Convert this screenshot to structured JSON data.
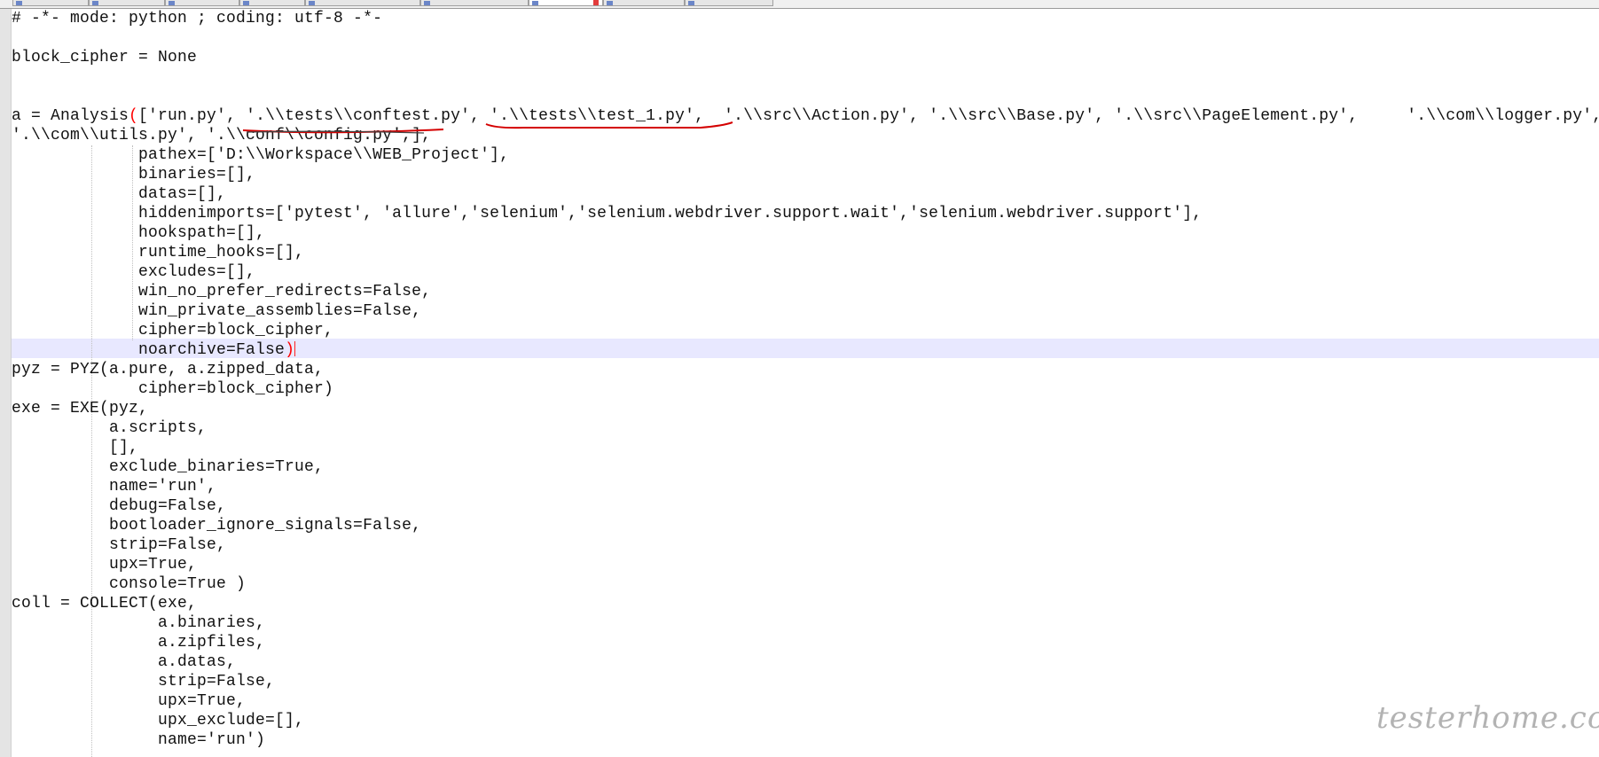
{
  "editor": {
    "lines": [
      {
        "text": "# -*- mode: python ; coding: utf-8 -*-"
      },
      {
        "text": ""
      },
      {
        "text": "block_cipher = None"
      },
      {
        "text": ""
      },
      {
        "text": ""
      },
      {
        "pre": "a = Analysis",
        "paren": "(",
        "post": "['run.py', '.\\\\tests\\\\conftest.py', '.\\\\tests\\\\test_1.py',  '.\\\\src\\\\Action.py', '.\\\\src\\\\Base.py', '.\\\\src\\\\PageElement.py',     '.\\\\com\\\\logger.py',"
      },
      {
        "text": "'.\\\\com\\\\utils.py', '.\\\\conf\\\\config.py',],"
      },
      {
        "text": "             pathex=['D:\\\\Workspace\\\\WEB_Project'],"
      },
      {
        "text": "             binaries=[],"
      },
      {
        "text": "             datas=[],"
      },
      {
        "text": "             hiddenimports=['pytest', 'allure','selenium','selenium.webdriver.support.wait','selenium.webdriver.support'],"
      },
      {
        "text": "             hookspath=[],"
      },
      {
        "text": "             runtime_hooks=[],"
      },
      {
        "text": "             excludes=[],"
      },
      {
        "text": "             win_no_prefer_redirects=False,"
      },
      {
        "text": "             win_private_assemblies=False,"
      },
      {
        "text": "             cipher=block_cipher,"
      },
      {
        "pre": "             noarchive=False",
        "paren": ")",
        "post": ""
      },
      {
        "text": "pyz = PYZ(a.pure, a.zipped_data,"
      },
      {
        "text": "             cipher=block_cipher)"
      },
      {
        "text": "exe = EXE(pyz,"
      },
      {
        "text": "          a.scripts,"
      },
      {
        "text": "          [],"
      },
      {
        "text": "          exclude_binaries=True,"
      },
      {
        "text": "          name='run',"
      },
      {
        "text": "          debug=False,"
      },
      {
        "text": "          bootloader_ignore_signals=False,"
      },
      {
        "text": "          strip=False,"
      },
      {
        "text": "          upx=True,"
      },
      {
        "text": "          console=True )"
      },
      {
        "text": "coll = COLLECT(exe,"
      },
      {
        "text": "               a.binaries,"
      },
      {
        "text": "               a.zipfiles,"
      },
      {
        "text": "               a.datas,"
      },
      {
        "text": "               strip=False,"
      },
      {
        "text": "               upx=True,"
      },
      {
        "text": "               upx_exclude=[],"
      },
      {
        "text": "               name='run')"
      }
    ],
    "current_line_index": 17
  },
  "watermark": "testerhome.com",
  "colors": {
    "text": "#111111",
    "bracket_highlight": "#ff0000",
    "current_line_bg": "#e8e8ff",
    "annotation_underline": "#d40000",
    "margin_bg": "#e4e4e4"
  }
}
